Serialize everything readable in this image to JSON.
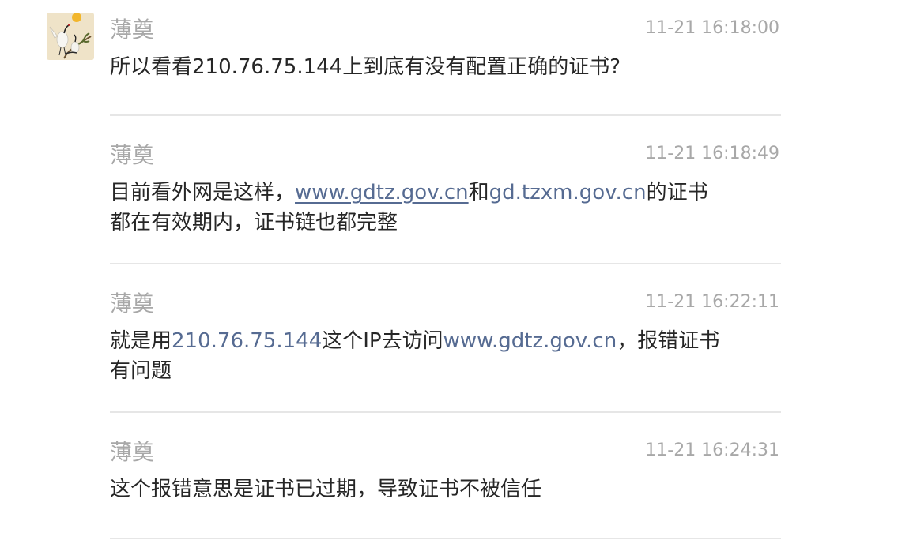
{
  "messages": [
    {
      "sender": "薄奠",
      "time": "11-21 16:18:00",
      "parts": [
        "所以看看210.76.75.144上到底有没有配置正确的证书?"
      ]
    },
    {
      "sender": "薄奠",
      "time": "11-21 16:18:49",
      "parts": [
        "目前看外网是这样，",
        "www.gdtz.gov.cn",
        "和",
        "gd.tzxm.gov.cn",
        "的证书",
        "都在有效期内，证书链也都完整"
      ]
    },
    {
      "sender": "薄奠",
      "time": "11-21 16:22:11",
      "parts": [
        "就是用",
        "210.76.75.144",
        "这个IP去访问",
        "www.gdtz.gov.cn",
        "，报错证书",
        "有问题"
      ]
    },
    {
      "sender": "薄奠",
      "time": "11-21 16:24:31",
      "parts": [
        "这个报错意思是证书已过期，导致证书不被信任"
      ]
    }
  ],
  "colors": {
    "sender": "#a8a8a8",
    "time": "#a8a8a8",
    "text": "#262626",
    "link": "#566b92",
    "divider": "#e6e6e6"
  },
  "icons": {
    "avatar": "crane-painting-avatar-icon"
  }
}
